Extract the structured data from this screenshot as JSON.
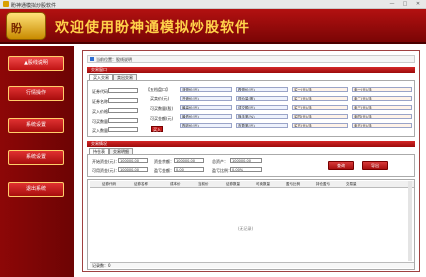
{
  "window": {
    "title": "盼神通模拟炒股软件",
    "minimize": "—",
    "maximize": "□",
    "close": "✕"
  },
  "banner": {
    "logo_text": "盼",
    "title": "欢迎使用盼神通模拟炒股软件"
  },
  "sidebar": {
    "items": [
      {
        "label": "▲股线说明"
      },
      {
        "label": "行情操作"
      },
      {
        "label": "系统设置"
      },
      {
        "label": "系统设置"
      },
      {
        "label": "退出系统"
      }
    ]
  },
  "breadcrumb": {
    "text": "当前位置：股线说明"
  },
  "trade": {
    "section_title": "交易窗口",
    "tabs": [
      "买入交易",
      "卖出交易"
    ],
    "labels": {
      "code": "证券代码：",
      "name": "证券名称：",
      "price": "买入价格：",
      "max": "可买数量：",
      "qty": "买入数量："
    },
    "values": {
      "code": "",
      "name": "",
      "price": "",
      "max": "",
      "qty": ""
    },
    "quote_label": "【五档盘口】",
    "quote_rows": [
      "买卖价(元)",
      "可买数量(股)",
      "可买金额(元)"
    ],
    "submit": "买入"
  },
  "quotes": {
    "rows": [
      [
        "涨停价(元)",
        "跌停价(元)",
        "买一(元)/手",
        "卖一(元)/手"
      ],
      [
        "开盘价(元)",
        "现价量(股)",
        "买二(元)/手",
        "卖二(元)/手"
      ],
      [
        "最高价(元)",
        "成交额(元)",
        "买三(元)/手",
        "卖三(元)/手"
      ],
      [
        "最低价(元)",
        "换手率(%)",
        "买四(元)/手",
        "卖四(元)/手"
      ],
      [
        "昨收价(元)",
        "市盈率(元)",
        "买五(元)/手",
        "卖五(元)/手"
      ]
    ]
  },
  "account": {
    "section_title": "交易情况",
    "tabs": [
      "持仓表",
      "交易明细"
    ],
    "labels": {
      "initial": "开始资金(元)：",
      "funds": "资金余额：",
      "total": "总资产：",
      "usable": "可用资金(元)：",
      "profit": "盈亏金额：",
      "ratio": "盈亏比例："
    },
    "values": {
      "initial": "100000.00",
      "funds": "100000.00",
      "total": "100000.00",
      "usable": "100000.00",
      "profit": "0.00",
      "ratio": "0.00%"
    },
    "query_btn": "查询",
    "export_btn": "导出"
  },
  "table": {
    "columns": [
      "证券代码",
      "证券名称",
      "成本价",
      "当前价",
      "证券数量",
      "可卖数量",
      "盈亏比例",
      "持仓盈亏",
      "交易量"
    ],
    "empty_text": "(无记录)"
  },
  "status": {
    "text": "记录数：0"
  }
}
